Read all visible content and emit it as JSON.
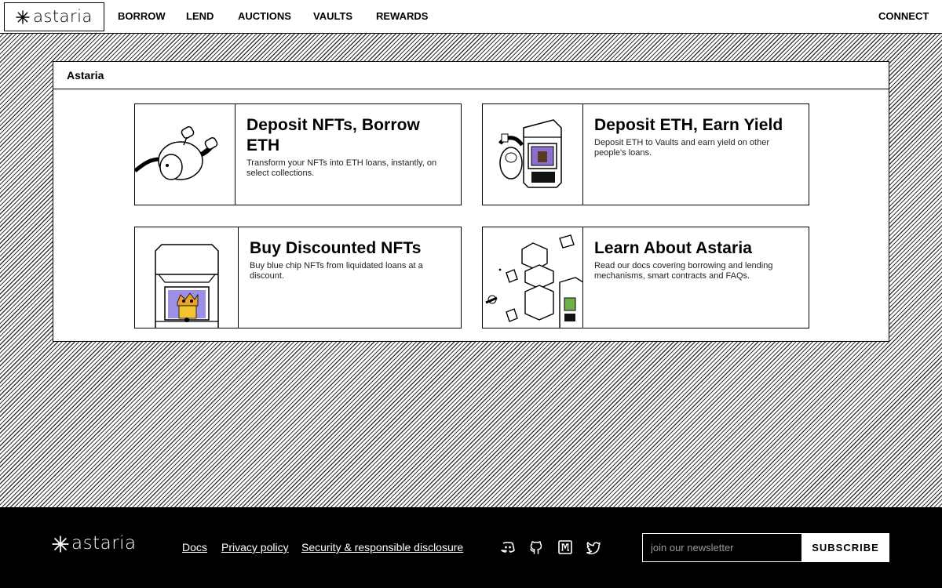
{
  "brand": {
    "name": "astaria"
  },
  "nav": {
    "items": [
      {
        "label": "BORROW"
      },
      {
        "label": "LEND"
      },
      {
        "label": "AUCTIONS"
      },
      {
        "label": "VAULTS"
      },
      {
        "label": "REWARDS"
      }
    ],
    "connect_label": "CONNECT"
  },
  "panel": {
    "title": "Astaria",
    "cards": [
      {
        "title": "Deposit NFTs, Borrow ETH",
        "description": "Transform your NFTs into ETH loans, instantly, on select collections.",
        "icon": "nft-pod-illustration"
      },
      {
        "title": "Deposit ETH, Earn Yield",
        "description": "Deposit ETH to Vaults and earn yield on other people's loans.",
        "icon": "vault-illustration"
      },
      {
        "title": "Buy Discounted NFTs",
        "description": "Buy blue chip NFTs from liquidated loans at a discount.",
        "icon": "nft-kiosk-illustration"
      },
      {
        "title": "Learn About Astaria",
        "description": "Read our docs covering borrowing and lending mechanisms, smart contracts and FAQs.",
        "icon": "modules-illustration"
      }
    ]
  },
  "footer": {
    "links": [
      {
        "label": "Docs"
      },
      {
        "label": "Privacy policy"
      },
      {
        "label": "Security & responsible disclosure"
      }
    ],
    "social_icons": [
      "discord-icon",
      "github-icon",
      "medium-icon",
      "twitter-icon"
    ],
    "newsletter": {
      "placeholder": "join our newsletter",
      "button_label": "SUBSCRIBE"
    }
  }
}
